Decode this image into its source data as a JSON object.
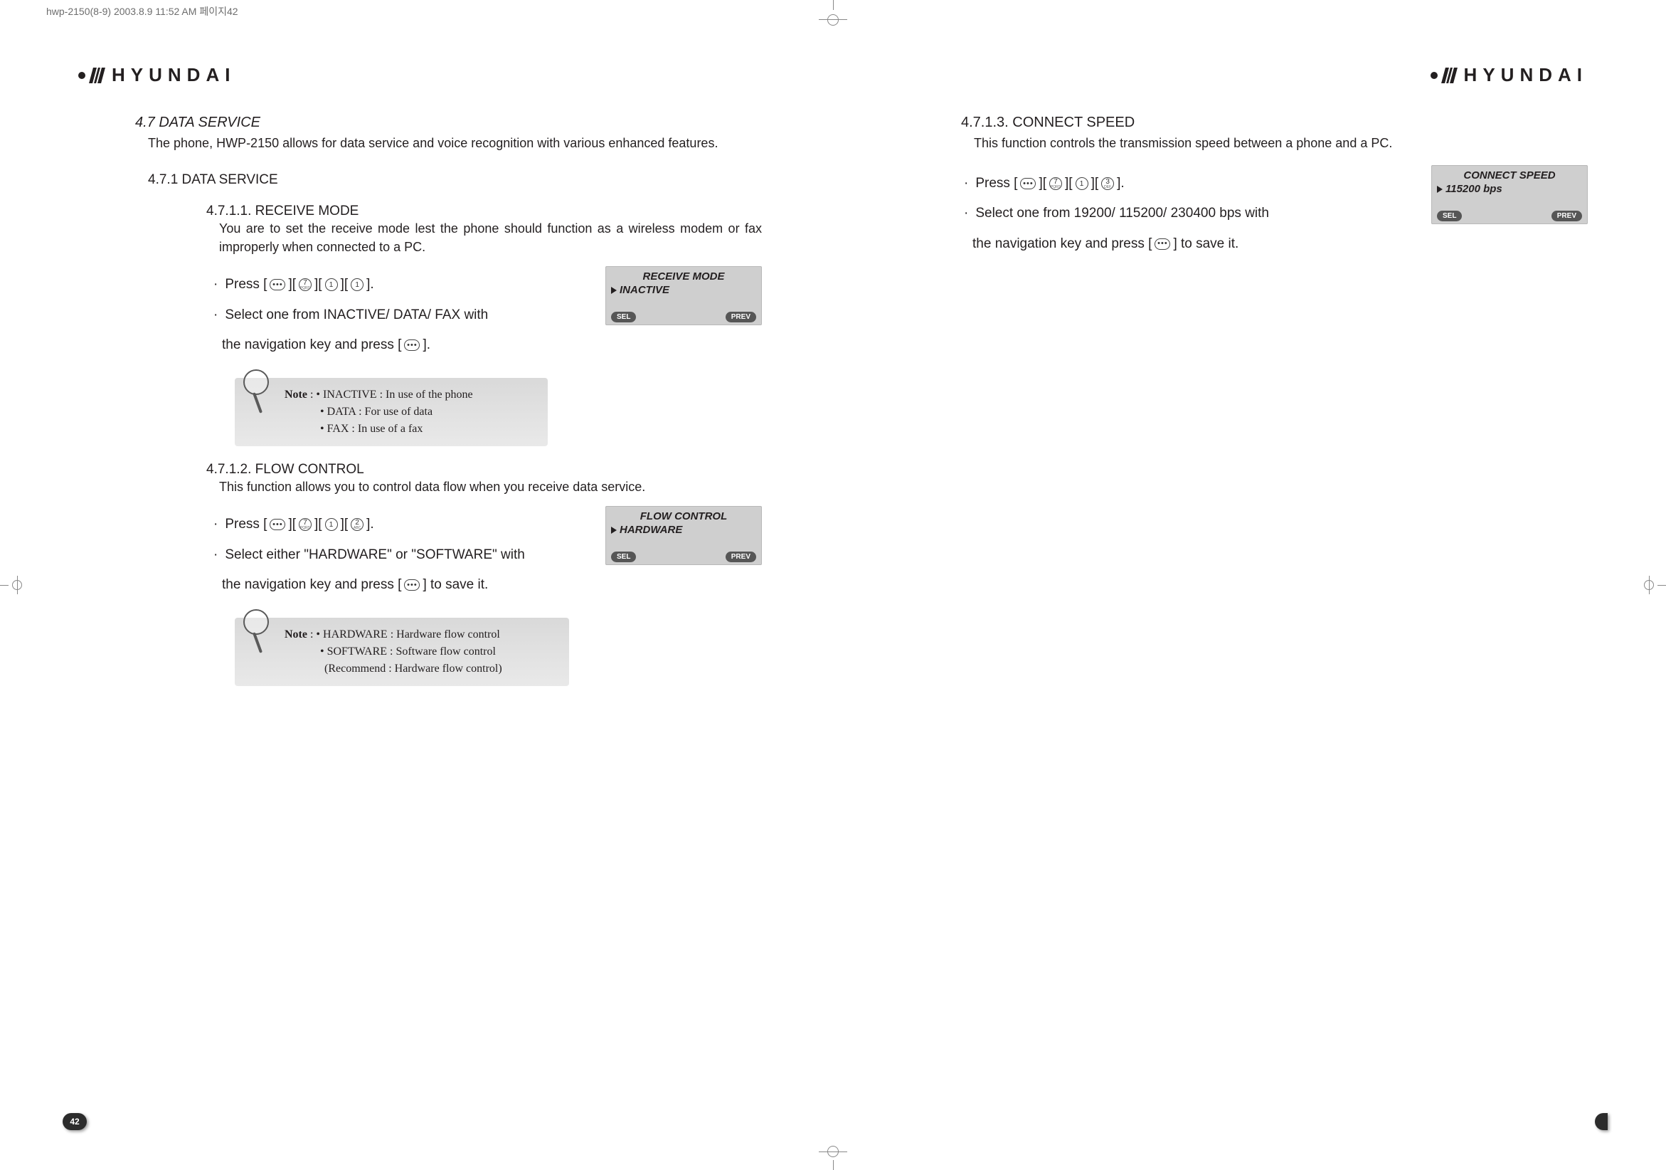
{
  "print_header": "hwp-2150(8-9)  2003.8.9 11:52 AM  페이지42",
  "logo_text": "HYUNDAI",
  "page_number_left": "42",
  "left": {
    "h1": "4.7 DATA SERVICE",
    "h1_desc": "The phone, HWP-2150 allows for data service and voice recognition with various enhanced features.",
    "h2": "4.7.1 DATA SERVICE",
    "s1_title": "4.7.1.1. RECEIVE MODE",
    "s1_desc": "You are to set the receive mode lest the phone should function as a wireless modem or fax improperly when connected to a PC.",
    "press_label": "Press [",
    "press_sep": "][",
    "press_close": "].",
    "s1_keys": [
      "7",
      "1",
      "1"
    ],
    "s1_select": "Select one from INACTIVE/ DATA/ FAX with",
    "s1_nav_a": "the navigation key and press [",
    "s1_nav_b": "].",
    "lcd1_title": "RECEIVE MODE",
    "lcd1_sel": "INACTIVE",
    "note1_label": "Note",
    "note1_l1": " : • INACTIVE : In use of the phone",
    "note1_l2": "• DATA : For use of data",
    "note1_l3": "• FAX : In use of a fax",
    "s2_title": "4.7.1.2. FLOW CONTROL",
    "s2_desc": "This function allows you to control data flow when you receive data service.",
    "s2_keys": [
      "7",
      "1",
      "2"
    ],
    "s2_select": "Select either \"HARDWARE\" or \"SOFTWARE\" with",
    "s2_nav_a": "the navigation key and press [",
    "s2_nav_b": "] to save it.",
    "lcd2_title": "FLOW CONTROL",
    "lcd2_sel": "HARDWARE",
    "note2_label": "Note",
    "note2_l1": " : • HARDWARE : Hardware flow control",
    "note2_l2": "• SOFTWARE : Software flow control",
    "note2_l3": "(Recommend : Hardware flow control)",
    "lcd_sel_btn": "SEL",
    "lcd_prev_btn": "PREV"
  },
  "right": {
    "title": "4.7.1.3. CONNECT SPEED",
    "desc": "This function controls the transmission speed between a phone and a PC.",
    "keys": [
      "7",
      "1",
      "3"
    ],
    "select": "Select one from 19200/ 115200/ 230400 bps with",
    "nav_a": "the navigation key and press [",
    "nav_b": "] to save it.",
    "lcd_title": "CONNECT SPEED",
    "lcd_sel": "115200  bps"
  }
}
